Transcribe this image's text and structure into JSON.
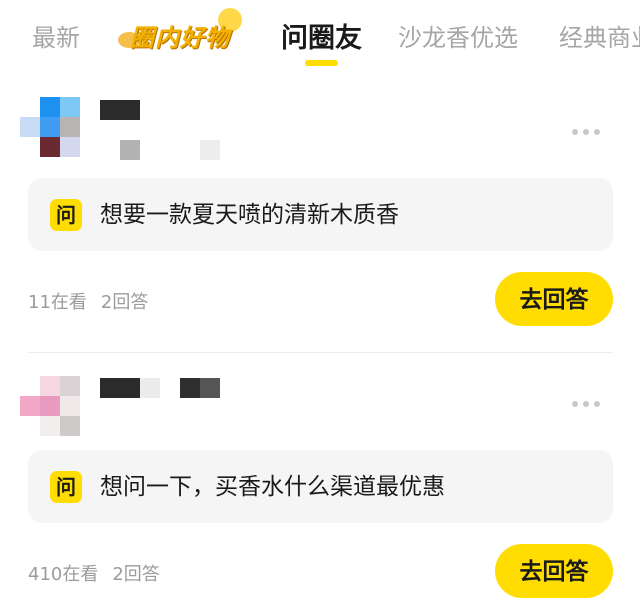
{
  "tabs": {
    "items": [
      {
        "label": "最新",
        "active": false
      },
      {
        "label": "圈内好物",
        "active": false,
        "type": "logo"
      },
      {
        "label": "问圈友",
        "active": true
      },
      {
        "label": "沙龙香优选",
        "active": false
      },
      {
        "label": "经典商业",
        "active": false
      }
    ],
    "accent": "#ffdd00"
  },
  "posts": [
    {
      "question_badge": "问",
      "question": "想要一款夏天喷的清新木质香",
      "views": "11在看",
      "answers": "2回答",
      "answer_button": "去回答",
      "more_icon": "more-horizontal-icon"
    },
    {
      "question_badge": "问",
      "question": "想问一下，买香水什么渠道最优惠",
      "views": "410在看",
      "answers": "2回答",
      "answer_button": "去回答",
      "more_icon": "more-horizontal-icon"
    }
  ],
  "colors": {
    "accent": "#ffdd00",
    "muted_text": "#9b9b9b",
    "card_bg": "#f5f5f5"
  }
}
